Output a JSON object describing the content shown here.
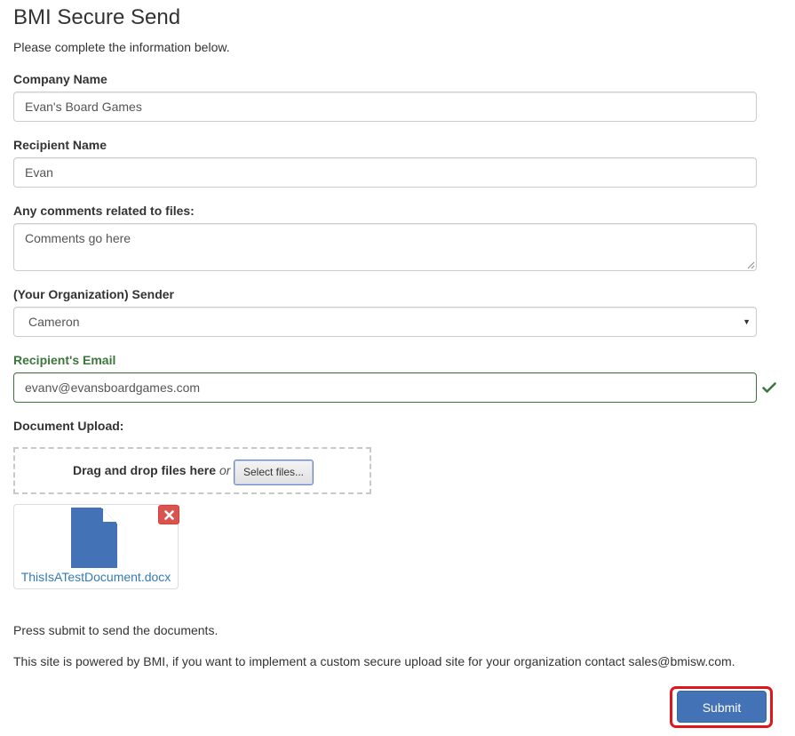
{
  "page": {
    "title": "BMI Secure Send",
    "intro": "Please complete the information below."
  },
  "form": {
    "company": {
      "label": "Company Name",
      "value": "Evan's Board Games"
    },
    "recipient": {
      "label": "Recipient Name",
      "value": "Evan"
    },
    "comments": {
      "label": "Any comments related to files:",
      "placeholder": "Comments go here"
    },
    "sender": {
      "label": "(Your Organization) Sender",
      "selected": "Cameron",
      "arrow": "▼"
    },
    "email": {
      "label": "Recipient's Email",
      "value": "evanv@evansboardgames.com",
      "status": "valid",
      "status_color": "#3c763d"
    },
    "upload": {
      "label": "Document Upload:",
      "drop_text": "Drag and drop files here",
      "or_text": "or",
      "select_button": "Select files...",
      "files": [
        {
          "name": "ThisIsATestDocument.docx",
          "icon": "document-icon",
          "remove_icon": "remove-icon"
        }
      ]
    }
  },
  "footer": {
    "press_submit": "Press submit to send the documents.",
    "powered_by": "This site is powered by BMI, if you want to implement a custom secure upload site for your organization contact sales@bmisw.com.",
    "submit_label": "Submit"
  },
  "colors": {
    "primary": "#4472b6",
    "danger": "#d9534f",
    "success": "#3c763d",
    "highlight": "#e0161c",
    "link": "#337ab7"
  }
}
